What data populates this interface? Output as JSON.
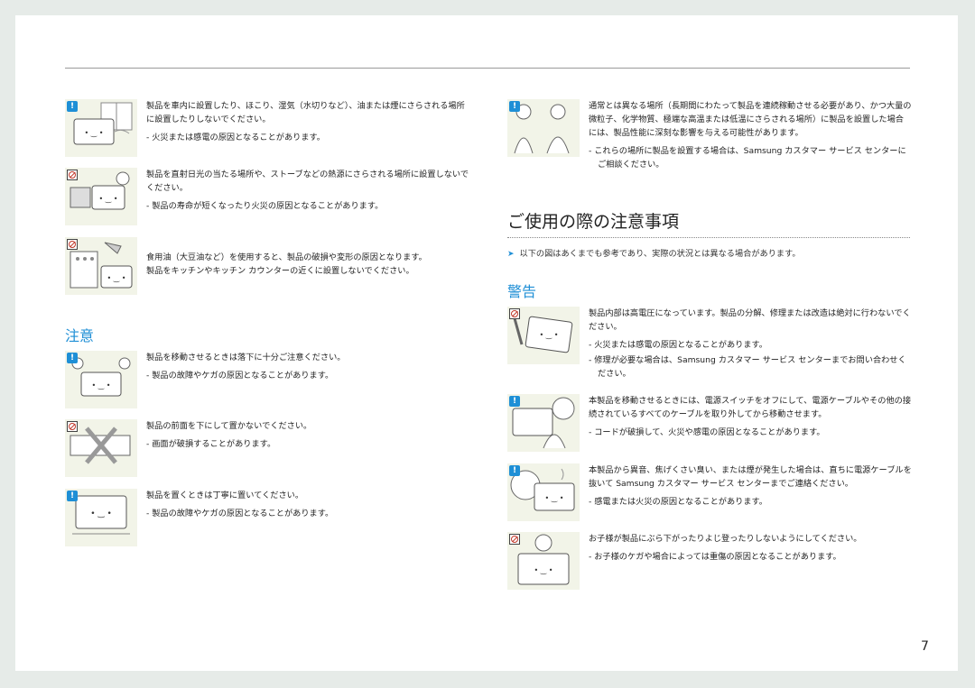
{
  "page_number": "7",
  "left_items_top": [
    {
      "main": "製品を車内に設置したり、ほこり、湿気（水切りなど）、油または煙にさらされる場所に設置したりしないでください。",
      "note": "-  火災または感電の原因となることがあります。",
      "badge": "info"
    },
    {
      "main": "製品を直射日光の当たる場所や、ストーブなどの熱源にさらされる場所に設置しないでください。",
      "note": "-  製品の寿命が短くなったり火災の原因となることがあります。",
      "badge": "prohibit"
    },
    {
      "main": "食用油（大豆油など）を使用すると、製品の破損や変形の原因となります。\n製品をキッチンやキッチン カウンターの近くに設置しないでください。",
      "note": "",
      "badge": "prohibit"
    }
  ],
  "caution_heading": "注意",
  "caution_items": [
    {
      "main": "製品を移動させるときは落下に十分ご注意ください。",
      "note": "-  製品の故障やケガの原因となることがあります。",
      "badge": "info"
    },
    {
      "main": "製品の前面を下にして置かないでください。",
      "note": "-  画面が破損することがあります。",
      "badge": "prohibit"
    },
    {
      "main": "製品を置くときは丁寧に置いてください。",
      "note": "-  製品の故障やケガの原因となることがあります。",
      "badge": "info"
    }
  ],
  "right_top_item": {
    "main": "通常とは異なる場所（長期間にわたって製品を連続稼動させる必要があり、かつ大量の微粒子、化学物質、極端な高温または低温にさらされる場所）に製品を設置した場合には、製品性能に深刻な影響を与える可能性があります。",
    "note": "-  これらの場所に製品を設置する場合は、Samsung カスタマー サービス センターにご相談ください。",
    "badge": "info"
  },
  "section_title": "ご使用の際の注意事項",
  "intro_text": "以下の図はあくまでも参考であり、実際の状況とは異なる場合があります。",
  "warning_heading": "警告",
  "warning_items": [
    {
      "main": "製品内部は高電圧になっています。製品の分解、修理または改造は絶対に行わないでください。",
      "note": "-  火災または感電の原因となることがあります。",
      "note2": "-  修理が必要な場合は、Samsung カスタマー サービス センターまでお問い合わせください。",
      "badge": "prohibit"
    },
    {
      "main": "本製品を移動させるときには、電源スイッチをオフにして、電源ケーブルやその他の接続されているすべてのケーブルを取り外してから移動させます。",
      "note": "-  コードが破損して、火災や感電の原因となることがあります。",
      "badge": "info"
    },
    {
      "main": "本製品から異音、焦げくさい臭い、または煙が発生した場合は、直ちに電源ケーブルを抜いて Samsung カスタマー サービス センターまでご連絡ください。",
      "note": "-  感電または火災の原因となることがあります。",
      "badge": "info"
    },
    {
      "main": "お子様が製品にぶら下がったりよじ登ったりしないようにしてください。",
      "note": "-  お子様のケガや場合によっては重傷の原因となることがあります。",
      "badge": "prohibit"
    }
  ]
}
